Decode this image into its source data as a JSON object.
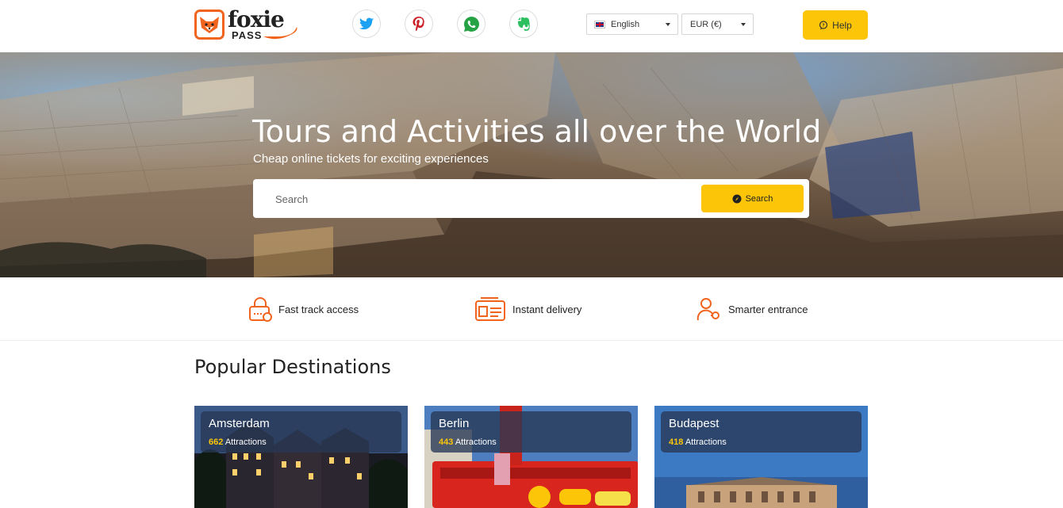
{
  "header": {
    "logo": {
      "word": "foxie",
      "sub": "PASS"
    },
    "social": [
      {
        "name": "twitter-icon",
        "color": "#1da1f2"
      },
      {
        "name": "pinterest-icon",
        "color": "#cb2027"
      },
      {
        "name": "whatsapp-icon",
        "color": "#25a244"
      },
      {
        "name": "evernote-icon",
        "color": "#2dbe60"
      }
    ],
    "language": "English",
    "currency": "EUR (€)",
    "help_label": "Help"
  },
  "hero": {
    "title": "Tours and Activities all over the World",
    "subtitle": "Cheap online tickets for exciting experiences",
    "search_placeholder": "Search",
    "search_button": "Search"
  },
  "features": [
    {
      "label": "Fast track access",
      "icon": "lock-icon"
    },
    {
      "label": "Instant delivery",
      "icon": "ticket-icon"
    },
    {
      "label": "Smarter entrance",
      "icon": "user-key-icon"
    }
  ],
  "popular": {
    "title": "Popular Destinations",
    "cards": [
      {
        "name": "Amsterdam",
        "count": "662",
        "suffix": "Attractions"
      },
      {
        "name": "Berlin",
        "count": "443",
        "suffix": "Attractions"
      },
      {
        "name": "Budapest",
        "count": "418",
        "suffix": "Attractions"
      }
    ]
  },
  "colors": {
    "accent": "#fcc508",
    "brand_orange": "#f0641e",
    "card_overlay": "#283755"
  }
}
